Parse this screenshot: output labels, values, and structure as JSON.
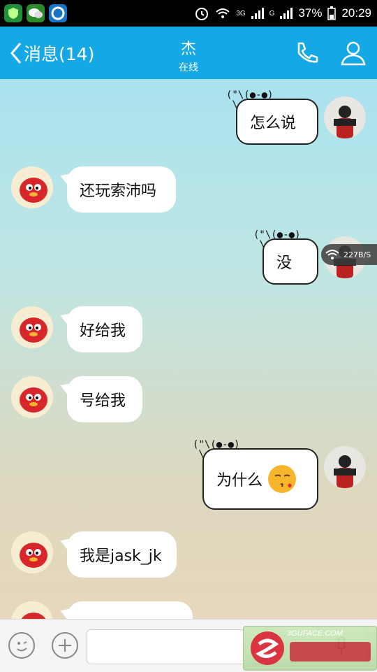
{
  "status": {
    "network1": "3G",
    "network2": "G",
    "battery": "37%",
    "time": "20:29"
  },
  "header": {
    "back_label": "消息(14)",
    "contact_name": "杰",
    "contact_status": "在线"
  },
  "messages": [
    {
      "side": "right",
      "text": "怎么说",
      "baymax": "(\"\\(●-●)\n \\ /    o"
    },
    {
      "side": "left",
      "text": "还玩索沛吗"
    },
    {
      "side": "right",
      "text": "没",
      "baymax": "(\"\\(●-●)\n \\ /    o"
    },
    {
      "side": "left",
      "text": "好给我"
    },
    {
      "side": "left",
      "text": "号给我"
    },
    {
      "side": "right",
      "text": "为什么",
      "baymax": "(\"\\(●-●)\n \\ /    o"
    },
    {
      "side": "left",
      "text": "我是jask_jk"
    }
  ],
  "speed_overlay": "227B/S",
  "watermark_text": "3GUFACE.COM"
}
